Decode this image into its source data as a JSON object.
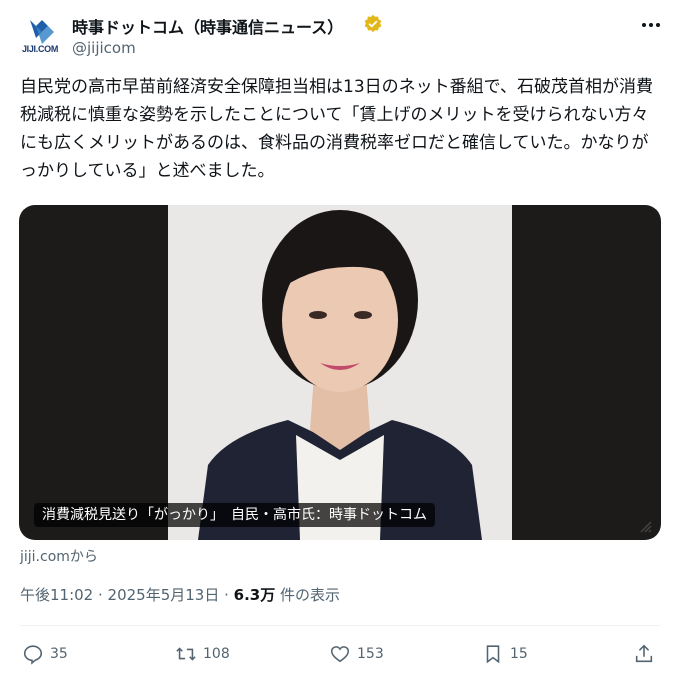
{
  "account": {
    "avatar_label": "JIJI.COM",
    "display_name": "時事ドットコム（時事通信ニュース）",
    "handle": "@jijicom",
    "verified_color": "#e2b719"
  },
  "post": {
    "text": "自民党の高市早苗前経済安全保障担当相は13日のネット番組で、石破茂首相が消費税減税に慎重な姿勢を示したことについて「賃上げのメリットを受けられない方々にも広くメリットがあるのは、食料品の消費税率ゼロだと確信していた。かなりがっかりしている」と述べました。",
    "media_caption": "消費減税見送り「がっかり」　自民・高市氏：時事ドットコム",
    "source_link": "jiji.comから",
    "time": "午後11:02 · 2025年5月13日 · ",
    "views": "6.3万",
    "views_label": " 件の表示"
  },
  "actions": {
    "replies": "35",
    "reposts": "108",
    "likes": "153",
    "bookmarks": "15"
  },
  "icons": {
    "more": "more-icon",
    "reply": "reply-icon",
    "repost": "repost-icon",
    "like": "like-icon",
    "bookmark": "bookmark-icon",
    "share": "share-icon",
    "verified": "verified-badge-icon"
  },
  "colors": {
    "text": "#0f1419",
    "secondary": "#536471",
    "divider": "#eff3f4"
  }
}
